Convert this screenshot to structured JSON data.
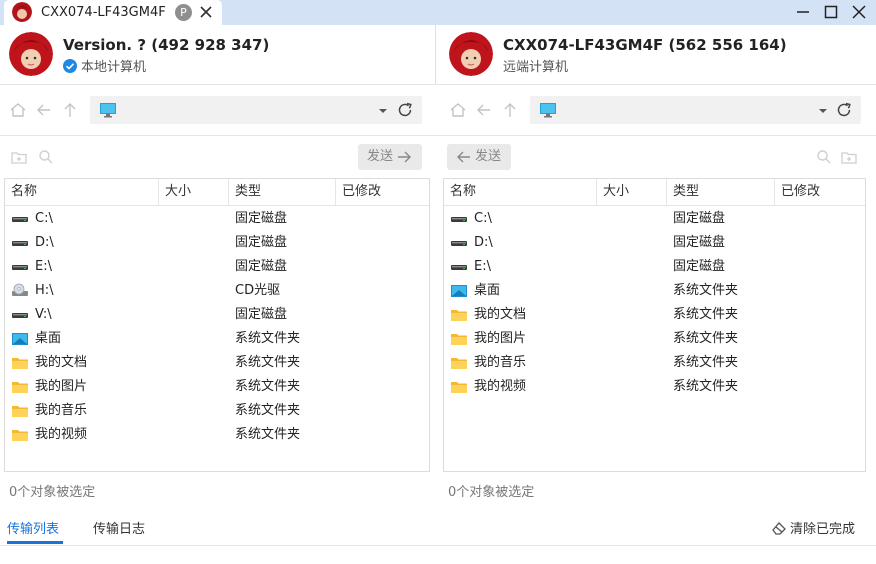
{
  "window": {
    "tab_title": "CXX074-LF43GM4F",
    "tab_badge": "P",
    "accent": "#1a73d9",
    "titlebar_color": "#d4e2f5"
  },
  "local": {
    "name": "Version. ? (492 928 347)",
    "subtitle": "本地计算机",
    "send_label": "发送",
    "columns": [
      "名称",
      "大小",
      "类型",
      "已修改"
    ],
    "rows": [
      {
        "icon": "drive-icon",
        "name": "C:\\",
        "size": "",
        "type": "固定磁盘",
        "modified": ""
      },
      {
        "icon": "drive-icon",
        "name": "D:\\",
        "size": "",
        "type": "固定磁盘",
        "modified": ""
      },
      {
        "icon": "drive-icon",
        "name": "E:\\",
        "size": "",
        "type": "固定磁盘",
        "modified": ""
      },
      {
        "icon": "cd-drive-icon",
        "name": "H:\\",
        "size": "",
        "type": "CD光驱",
        "modified": ""
      },
      {
        "icon": "drive-icon",
        "name": "V:\\",
        "size": "",
        "type": "固定磁盘",
        "modified": ""
      },
      {
        "icon": "desktop-icon",
        "name": "桌面",
        "size": "",
        "type": "系统文件夹",
        "modified": ""
      },
      {
        "icon": "folder-icon",
        "name": "我的文档",
        "size": "",
        "type": "系统文件夹",
        "modified": ""
      },
      {
        "icon": "folder-icon",
        "name": "我的图片",
        "size": "",
        "type": "系统文件夹",
        "modified": ""
      },
      {
        "icon": "folder-icon",
        "name": "我的音乐",
        "size": "",
        "type": "系统文件夹",
        "modified": ""
      },
      {
        "icon": "folder-icon",
        "name": "我的视频",
        "size": "",
        "type": "系统文件夹",
        "modified": ""
      }
    ],
    "status": "0个对象被选定"
  },
  "remote": {
    "name": "CXX074-LF43GM4F (562 556 164)",
    "subtitle": "远端计算机",
    "send_label": "发送",
    "columns": [
      "名称",
      "大小",
      "类型",
      "已修改"
    ],
    "rows": [
      {
        "icon": "drive-icon",
        "name": "C:\\",
        "size": "",
        "type": "固定磁盘",
        "modified": ""
      },
      {
        "icon": "drive-icon",
        "name": "D:\\",
        "size": "",
        "type": "固定磁盘",
        "modified": ""
      },
      {
        "icon": "drive-icon",
        "name": "E:\\",
        "size": "",
        "type": "固定磁盘",
        "modified": ""
      },
      {
        "icon": "desktop-icon",
        "name": "桌面",
        "size": "",
        "type": "系统文件夹",
        "modified": ""
      },
      {
        "icon": "folder-icon",
        "name": "我的文档",
        "size": "",
        "type": "系统文件夹",
        "modified": ""
      },
      {
        "icon": "folder-icon",
        "name": "我的图片",
        "size": "",
        "type": "系统文件夹",
        "modified": ""
      },
      {
        "icon": "folder-icon",
        "name": "我的音乐",
        "size": "",
        "type": "系统文件夹",
        "modified": ""
      },
      {
        "icon": "folder-icon",
        "name": "我的视频",
        "size": "",
        "type": "系统文件夹",
        "modified": ""
      }
    ],
    "status": "0个对象被选定"
  },
  "bottom": {
    "tab_transfer": "传输列表",
    "tab_log": "传输日志",
    "clear_label": "清除已完成"
  }
}
